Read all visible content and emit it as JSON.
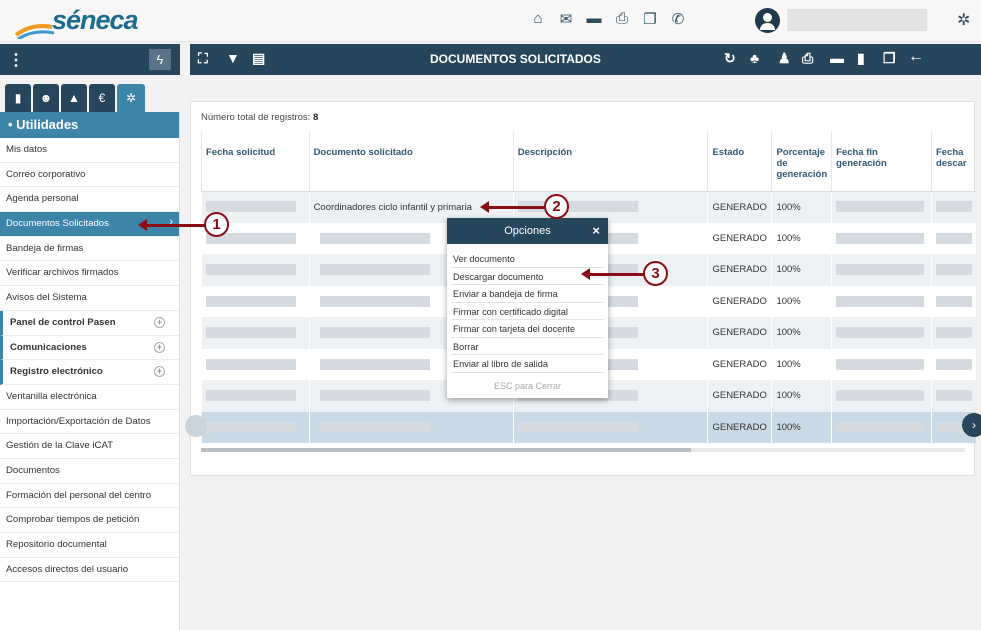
{
  "app": {
    "logo_text": "séneca"
  },
  "topbar": {
    "icons": [
      "home-icon",
      "envelope-icon",
      "folder-icon",
      "print-icon",
      "copy-icon",
      "phone-icon",
      "gear-icon"
    ]
  },
  "sidebar": {
    "tabs": [
      "document-icon",
      "users-icon",
      "graduation-cap-icon",
      "euro-icon",
      "cogs-icon"
    ],
    "header": "• Utilidades",
    "items": [
      {
        "label": "Mis datos"
      },
      {
        "label": "Correo corporativo"
      },
      {
        "label": "Agenda personal"
      },
      {
        "label": "Documentos Solicitados",
        "active": true
      },
      {
        "label": "Bandeja de firmas"
      },
      {
        "label": "Verificar archivos firmados"
      },
      {
        "label": "Avisos del Sistema"
      },
      {
        "label": "Panel de control Pasen",
        "group": true
      },
      {
        "label": "Comunicaciones",
        "group": true
      },
      {
        "label": "Registro electrónico",
        "group": true
      },
      {
        "label": "Ventanilla electrónica"
      },
      {
        "label": "Importación/Exportación de Datos"
      },
      {
        "label": "Gestión de la Clave iCAT"
      },
      {
        "label": "Documentos"
      },
      {
        "label": "Formación del personal del centro"
      },
      {
        "label": "Comprobar tiempos de petición"
      },
      {
        "label": "Repositorio documental"
      },
      {
        "label": "Accesos directos del usuario"
      }
    ]
  },
  "main": {
    "title": "DOCUMENTOS SOLICITADOS",
    "count_label": "Número total de registros:",
    "count_value": "8",
    "columns": [
      "Fecha solicitud",
      "Documento solicitado",
      "Descripción",
      "Estado",
      "Porcentaje de generación",
      "Fecha fin generación",
      "Fecha descar"
    ],
    "rows": [
      {
        "documento": "Coordinadores ciclo infantil y primaria",
        "estado": "GENERADO",
        "porcentaje": "100%"
      },
      {
        "documento": "",
        "estado": "GENERADO",
        "porcentaje": "100%"
      },
      {
        "documento": "",
        "estado": "GENERADO",
        "porcentaje": "100%"
      },
      {
        "documento": "",
        "estado": "GENERADO",
        "porcentaje": "100%"
      },
      {
        "documento": "",
        "estado": "GENERADO",
        "porcentaje": "100%"
      },
      {
        "documento": "",
        "estado": "GENERADO",
        "porcentaje": "100%"
      },
      {
        "documento": "",
        "estado": "GENERADO",
        "porcentaje": "100%"
      },
      {
        "documento": "",
        "estado": "GENERADO",
        "porcentaje": "100%"
      }
    ]
  },
  "popup": {
    "title": "Opciones",
    "close": "×",
    "items": [
      "Ver documento",
      "Descargar documento",
      "Enviar a bandeja de firma",
      "Firmar con certificado digital",
      "Firmar con tarjeta del docente",
      "Borrar",
      "Enviar al libro de salida"
    ],
    "esc": "ESC para Cerrar"
  },
  "callouts": [
    "1",
    "2",
    "3"
  ]
}
